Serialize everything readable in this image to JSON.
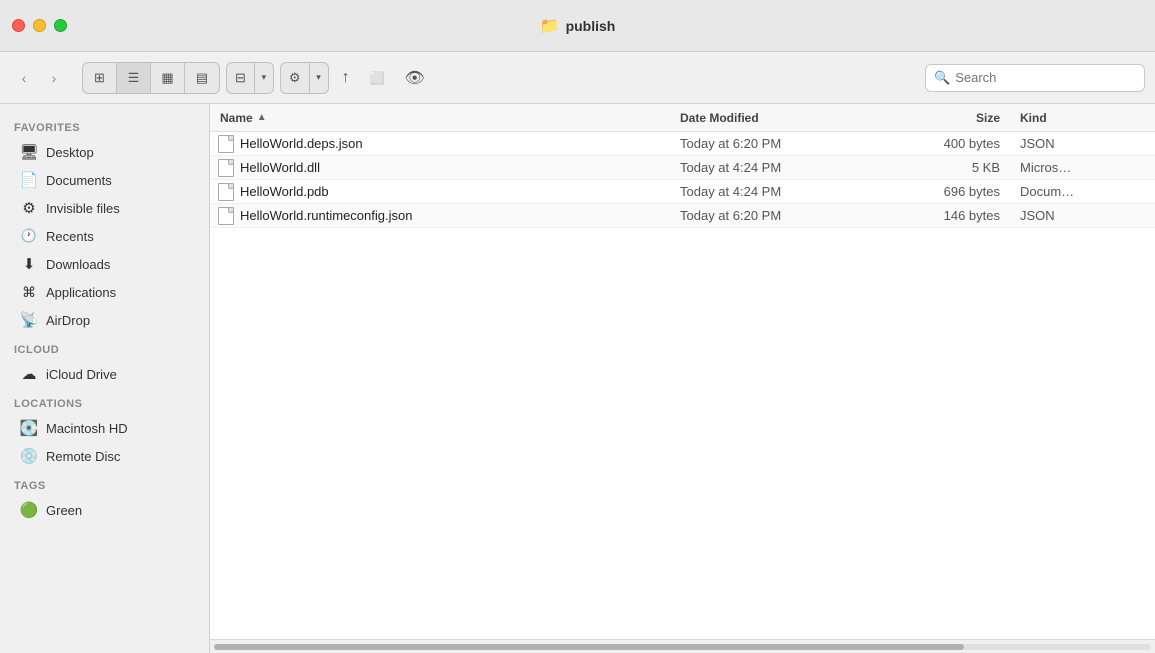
{
  "titleBar": {
    "title": "publish",
    "folderIcon": "📁"
  },
  "toolbar": {
    "backLabel": "‹",
    "forwardLabel": "›",
    "viewIcons": [
      "⊞",
      "☰",
      "▦",
      "▤"
    ],
    "activeView": 1,
    "gearLabel": "⚙",
    "dropdownArrow": "▾",
    "shareLabel": "↑",
    "tagLabel": "⬜",
    "eyeLabel": "👁",
    "searchPlaceholder": "Search"
  },
  "sidebar": {
    "sections": [
      {
        "header": "Favorites",
        "items": [
          {
            "id": "desktop",
            "icon": "🖥",
            "label": "Desktop"
          },
          {
            "id": "documents",
            "icon": "📄",
            "label": "Documents"
          },
          {
            "id": "invisible-files",
            "icon": "⚙",
            "label": "Invisible files"
          },
          {
            "id": "recents",
            "icon": "🕐",
            "label": "Recents"
          },
          {
            "id": "downloads",
            "icon": "⬇",
            "label": "Downloads"
          },
          {
            "id": "applications",
            "icon": "⌘",
            "label": "Applications"
          },
          {
            "id": "airdrop",
            "icon": "📡",
            "label": "AirDrop"
          }
        ]
      },
      {
        "header": "iCloud",
        "items": [
          {
            "id": "icloud-drive",
            "icon": "☁",
            "label": "iCloud Drive"
          }
        ]
      },
      {
        "header": "Locations",
        "items": [
          {
            "id": "macintosh-hd",
            "icon": "💽",
            "label": "Macintosh HD"
          },
          {
            "id": "remote-disc",
            "icon": "💿",
            "label": "Remote Disc"
          }
        ]
      },
      {
        "header": "Tags",
        "items": [
          {
            "id": "green-tag",
            "icon": "🟢",
            "label": "Green"
          }
        ]
      }
    ]
  },
  "fileList": {
    "columns": [
      {
        "id": "name",
        "label": "Name",
        "sortActive": true,
        "sortDir": "asc"
      },
      {
        "id": "date",
        "label": "Date Modified"
      },
      {
        "id": "size",
        "label": "Size"
      },
      {
        "id": "kind",
        "label": "Kind"
      }
    ],
    "files": [
      {
        "name": "HelloWorld.deps.json",
        "date": "Today at 6:20 PM",
        "size": "400 bytes",
        "kind": "JSON"
      },
      {
        "name": "HelloWorld.dll",
        "date": "Today at 4:24 PM",
        "size": "5 KB",
        "kind": "Micros…"
      },
      {
        "name": "HelloWorld.pdb",
        "date": "Today at 4:24 PM",
        "size": "696 bytes",
        "kind": "Docum…"
      },
      {
        "name": "HelloWorld.runtimeconfig.json",
        "date": "Today at 6:20 PM",
        "size": "146 bytes",
        "kind": "JSON"
      }
    ]
  }
}
